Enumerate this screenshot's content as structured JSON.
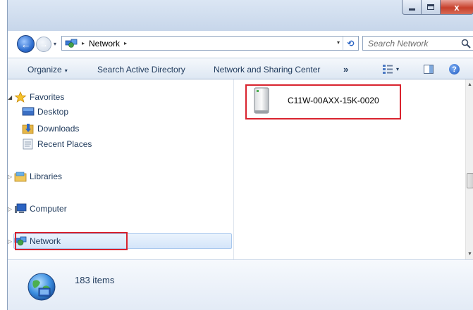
{
  "window": {
    "caption_buttons": {
      "minimize_icon": "minimize-icon",
      "maximize_icon": "maximize-icon",
      "close_glyph": "x"
    }
  },
  "address_bar": {
    "location": "Network",
    "separator_glyph": "▸",
    "dropdown_glyph": "▾",
    "refresh_glyph": "⟲"
  },
  "search": {
    "placeholder": "Search Network"
  },
  "command_bar": {
    "items": [
      "Organize",
      "Search Active Directory",
      "Network and Sharing Center"
    ],
    "organize_caret": "▾",
    "more_glyph": "»",
    "view_caret": "▾",
    "help_glyph": "?"
  },
  "nav_pane": {
    "favorites": {
      "label": "Favorites",
      "children": [
        "Desktop",
        "Downloads",
        "Recent Places"
      ]
    },
    "libraries": "Libraries",
    "computer": "Computer",
    "network": "Network",
    "expanded_arrow": "◢",
    "collapsed_arrow": "▷"
  },
  "content": {
    "items": [
      {
        "name": "C11W-00AXX-15K-0020",
        "icon": "network-device-icon"
      }
    ]
  },
  "details": {
    "summary": "183 items"
  },
  "colors": {
    "annotation": "#d9232e",
    "selection": "#d4e5f9",
    "titlebar": "#c7d6ea"
  }
}
